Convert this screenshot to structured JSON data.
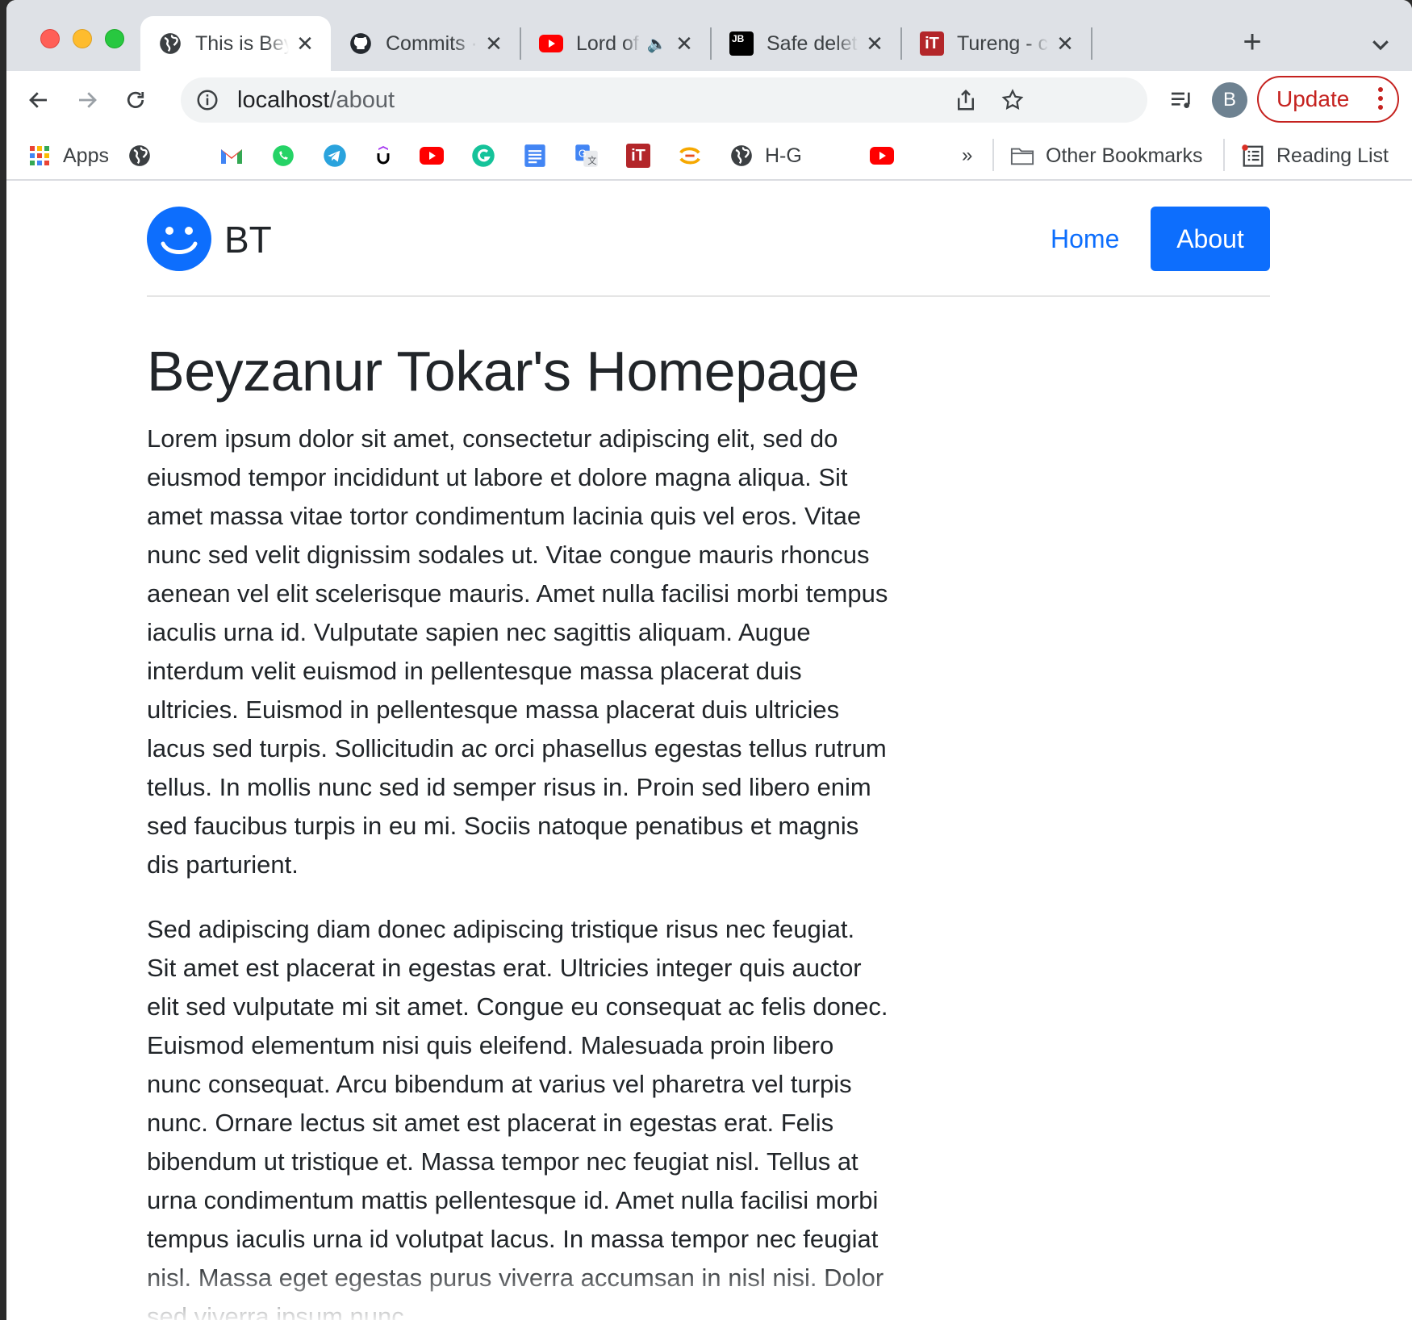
{
  "tabs": [
    {
      "title": "This is Beyzanur Tokar's Homepage",
      "favicon": "globe-icon",
      "active": true
    },
    {
      "title": "Commits · Beyzanur",
      "favicon": "github-icon"
    },
    {
      "title": "Lord of the Rings",
      "favicon": "youtube-icon",
      "audio": true
    },
    {
      "title": "Safe delete",
      "favicon": "jetbrains-icon"
    },
    {
      "title": "Tureng - control",
      "favicon": "tureng-icon"
    }
  ],
  "address": {
    "host": "localhost",
    "path": "/about"
  },
  "profile_initial": "B",
  "update_label": "Update",
  "bookmarks": {
    "apps_label": "Apps",
    "hg_label": "H-G",
    "more": "»",
    "other_label": "Other Bookmarks",
    "reading_label": "Reading List"
  },
  "site": {
    "brand": "BT",
    "nav": {
      "home": "Home",
      "about": "About"
    },
    "heading": "Beyzanur Tokar's Homepage",
    "paragraphs": [
      "Lorem ipsum dolor sit amet, consectetur adipiscing elit, sed do eiusmod tempor incididunt ut labore et dolore magna aliqua. Sit amet massa vitae tortor condimentum lacinia quis vel eros. Vitae nunc sed velit dignissim sodales ut. Vitae congue mauris rhoncus aenean vel elit scelerisque mauris. Amet nulla facilisi morbi tempus iaculis urna id. Vulputate sapien nec sagittis aliquam. Augue interdum velit euismod in pellentesque massa placerat duis ultricies. Euismod in pellentesque massa placerat duis ultricies lacus sed turpis. Sollicitudin ac orci phasellus egestas tellus rutrum tellus. In mollis nunc sed id semper risus in. Proin sed libero enim sed faucibus turpis in eu mi. Sociis natoque penatibus et magnis dis parturient.",
      "Sed adipiscing diam donec adipiscing tristique risus nec feugiat. Sit amet est placerat in egestas erat. Ultricies integer quis auctor elit sed vulputate mi sit amet. Congue eu consequat ac felis donec. Euismod elementum nisi quis eleifend. Malesuada proin libero nunc consequat. Arcu bibendum at varius vel pharetra vel turpis nunc. Ornare lectus sit amet est placerat in egestas erat. Felis bibendum ut tristique et. Massa tempor nec feugiat nisl. Tellus at urna condimentum mattis pellentesque id. Amet nulla facilisi morbi tempus iaculis urna id volutpat lacus. In massa tempor nec feugiat nisl. Massa eget egestas purus viverra accumsan in nisl nisi. Dolor sed viverra ipsum nunc."
    ]
  },
  "colors": {
    "primary": "#0d6efd",
    "update": "#c5221f"
  }
}
